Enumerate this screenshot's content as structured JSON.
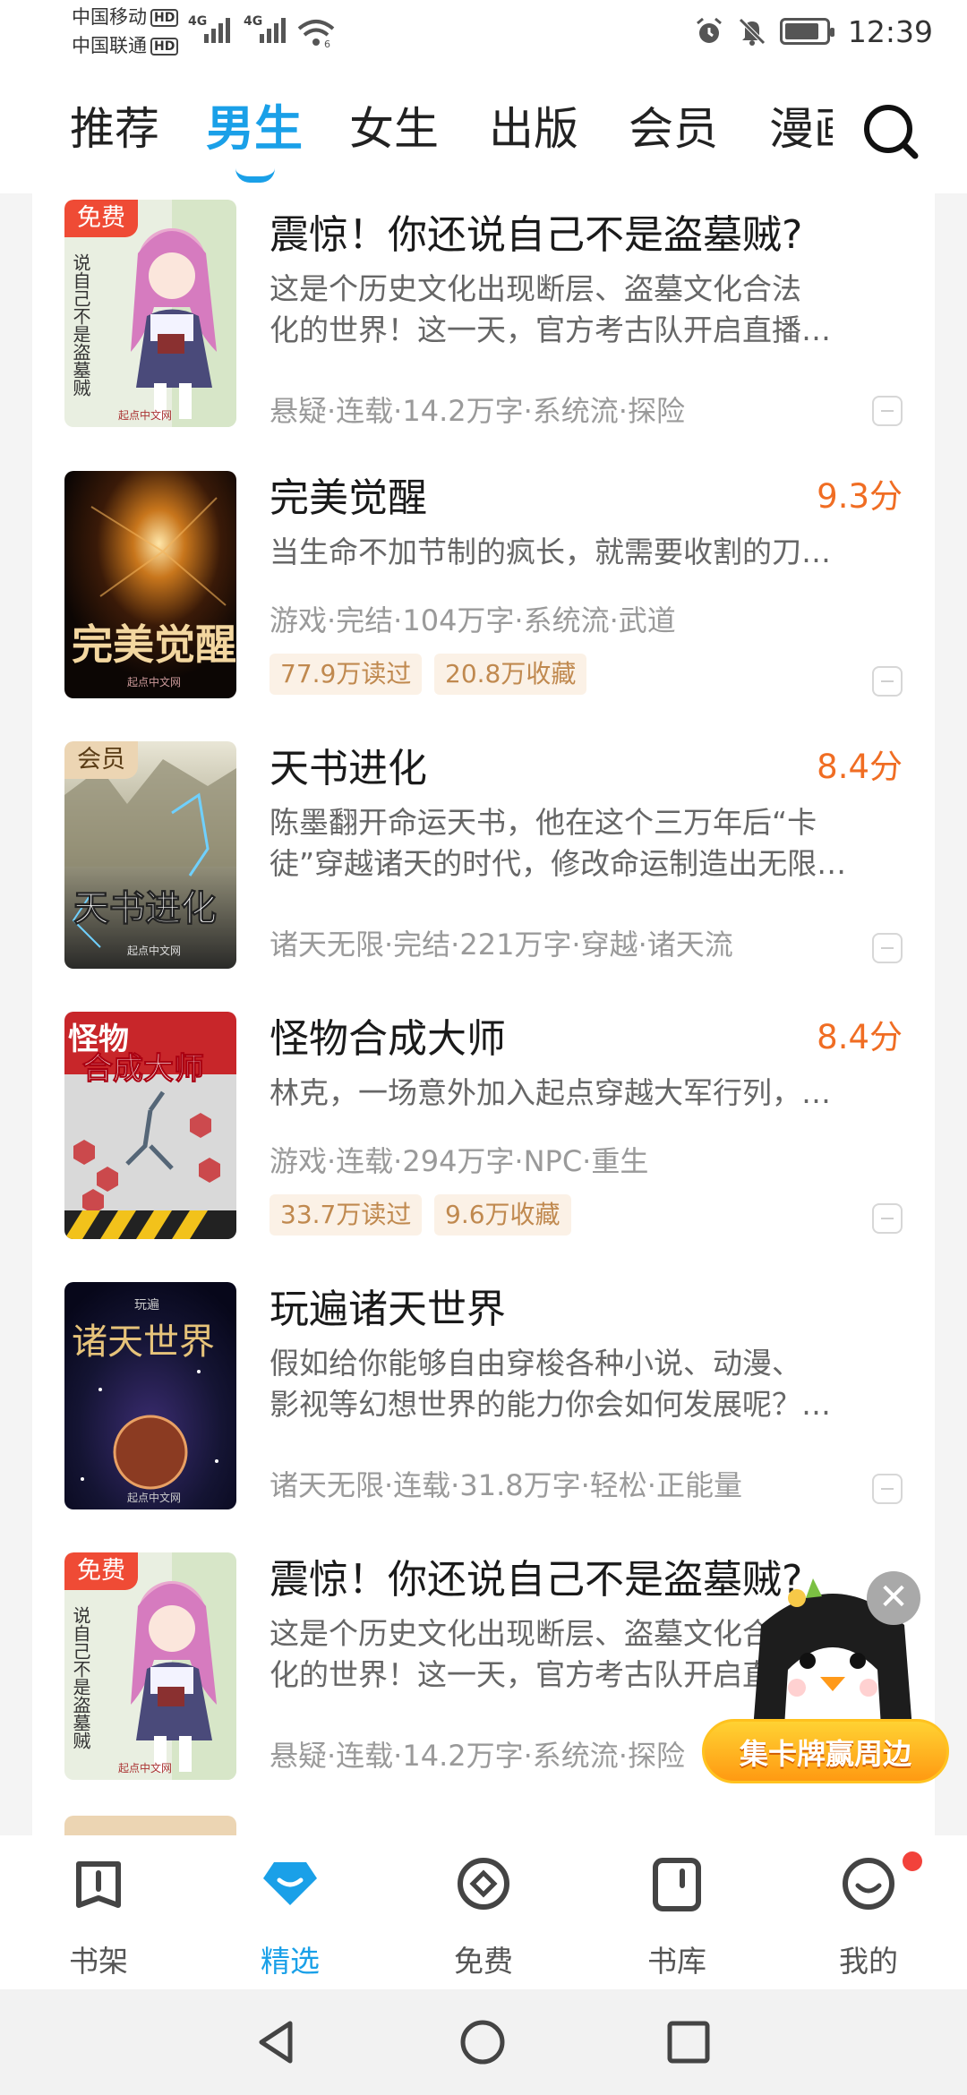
{
  "status_bar": {
    "carrier_1": "中国移动",
    "carrier_2": "中国联通",
    "hd": "HD",
    "net_1": "4G",
    "net_2": "4G",
    "battery_level": 0.85,
    "time": "12:39",
    "icons": [
      "signal-icon",
      "wifi-icon",
      "alarm-icon",
      "mute-icon",
      "battery-icon"
    ]
  },
  "top_tabs": [
    {
      "label": "推荐",
      "active": false
    },
    {
      "label": "男生",
      "active": true
    },
    {
      "label": "女生",
      "active": false
    },
    {
      "label": "出版",
      "active": false
    },
    {
      "label": "会员",
      "active": false
    },
    {
      "label": "漫画",
      "active": false
    }
  ],
  "accent_color": "#1aa0e8",
  "books": [
    {
      "title": "震惊！你还说自己不是盗墓贼?",
      "badge": "免费",
      "score": "",
      "desc_1": "这是个历史文化出现断层、盗墓文化合法",
      "desc_2": "化的世界！这一天，官方考古队开启直播…",
      "meta": "悬疑·连载·14.2万字·系统流·探险",
      "reads": "",
      "favs": "",
      "cover_text": "说自己不是盗墓贼"
    },
    {
      "title": "完美觉醒",
      "badge": "",
      "score": "9.3分",
      "desc_1": "当生命不加节制的疯长，就需要收割的刀…",
      "desc_2": "",
      "meta": "游戏·完结·104万字·系统流·武道",
      "reads": "77.9万读过",
      "favs": "20.8万收藏",
      "cover_text": "完美觉醒"
    },
    {
      "title": "天书进化",
      "badge": "会员",
      "score": "8.4分",
      "desc_1": "陈墨翻开命运天书，他在这个三万年后“卡",
      "desc_2": "徒”穿越诸天的时代，修改命运制造出无限…",
      "meta": "诸天无限·完结·221万字·穿越·诸天流",
      "reads": "",
      "favs": "",
      "cover_text": "天书进化"
    },
    {
      "title": "怪物合成大师",
      "badge": "",
      "score": "8.4分",
      "desc_1": "林克，一场意外加入起点穿越大军行列，…",
      "desc_2": "",
      "meta": "游戏·连载·294万字·NPC·重生",
      "reads": "33.7万读过",
      "favs": "9.6万收藏",
      "cover_text": "怪物合成大师"
    },
    {
      "title": "玩遍诸天世界",
      "badge": "",
      "score": "",
      "desc_1": "假如给你能够自由穿梭各种小说、动漫、",
      "desc_2": "影视等幻想世界的能力你会如何发展呢？…",
      "meta": "诸天无限·连载·31.8万字·轻松·正能量",
      "reads": "",
      "favs": "",
      "cover_text": "诸天世界"
    },
    {
      "title": "震惊！你还说自己不是盗墓贼?",
      "badge": "免费",
      "score": "",
      "desc_1": "这是个历史文化出现断层、盗墓文化合法",
      "desc_2": "化的世界！这一天，官方考古队开启直播…",
      "meta": "悬疑·连载·14.2万字·系统流·探险",
      "reads": "",
      "favs": "",
      "cover_text": "说自己不是盗墓贼"
    }
  ],
  "promo": {
    "label": "集卡牌赢周边",
    "close": "✕"
  },
  "bottom_nav": [
    {
      "label": "书架",
      "icon": "bookshelf-icon",
      "active": false
    },
    {
      "label": "精选",
      "icon": "featured-icon",
      "active": true
    },
    {
      "label": "免费",
      "icon": "free-icon",
      "active": false
    },
    {
      "label": "书库",
      "icon": "library-icon",
      "active": false
    },
    {
      "label": "我的",
      "icon": "profile-icon",
      "active": false
    }
  ]
}
